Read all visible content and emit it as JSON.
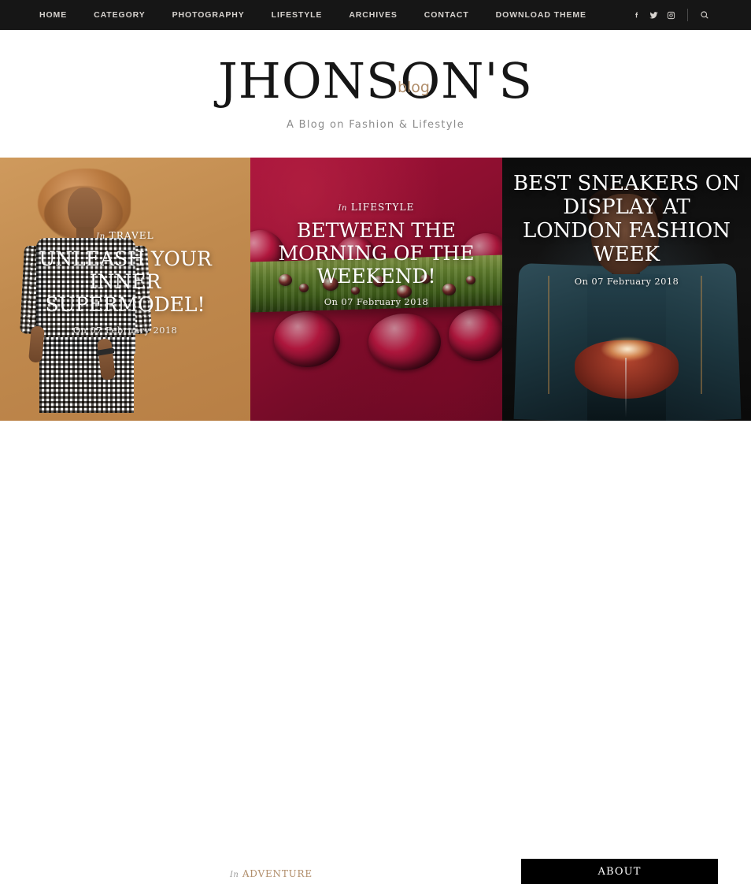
{
  "site": {
    "logo_main": "JHONSON'S",
    "logo_badge": "blog",
    "tagline": "A Blog on Fashion & Lifestyle",
    "accent_color": "#b08d6a",
    "nav_bg_color": "#161616"
  },
  "nav": {
    "items": [
      {
        "label": "HOME"
      },
      {
        "label": "CATEGORY"
      },
      {
        "label": "PHOTOGRAPHY"
      },
      {
        "label": "LIFESTYLE"
      },
      {
        "label": "ARCHIVES"
      },
      {
        "label": "CONTACT"
      },
      {
        "label": "DOWNLOAD THEME"
      }
    ],
    "social": [
      {
        "name": "facebook-icon"
      },
      {
        "name": "twitter-icon"
      },
      {
        "name": "instagram-icon"
      }
    ],
    "search_icon": "search-icon"
  },
  "slider": {
    "prev_label": "←",
    "next_label": "→",
    "slides": [
      {
        "in_label": "In",
        "category": "TRAVEL",
        "title": "UNLEASH YOUR INNER SUPERMODEL!",
        "date": "On 07 February 2018",
        "bg_color": "#c08a4e"
      },
      {
        "in_label": "In",
        "category": "LIFESTYLE",
        "title": "BETWEEN THE MORNING OF THE WEEKEND!",
        "date": "On 07 February 2018",
        "bg_color": "#8c0f2f"
      },
      {
        "in_label": "",
        "category": "",
        "title": "BEST SNEAKERS ON DISPLAY AT LONDON FASHION WEEK",
        "date": "On 07 February 2018",
        "bg_color": "#101010"
      }
    ]
  },
  "bottom": {
    "in_label": "In",
    "category": "ADVENTURE",
    "about_label": "ABOUT"
  }
}
